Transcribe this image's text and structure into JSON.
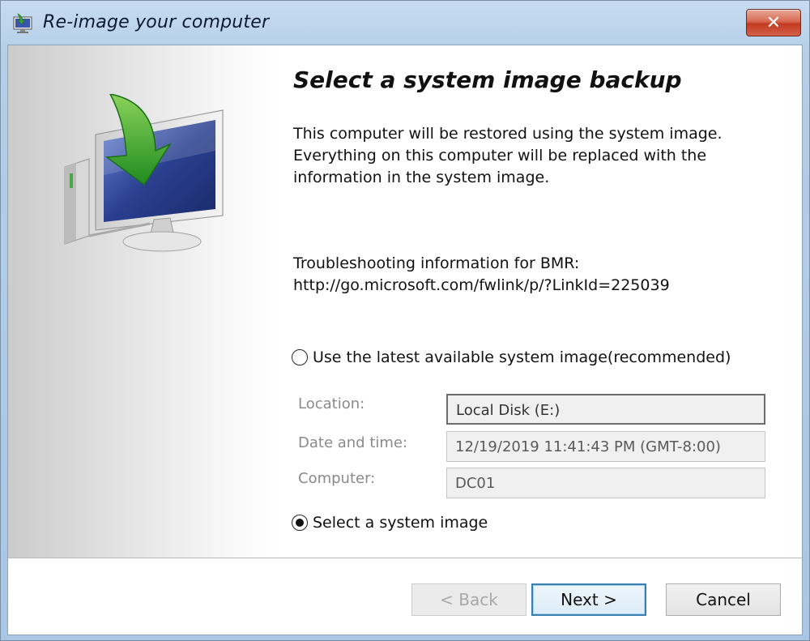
{
  "window": {
    "title": "Re-image your computer",
    "close_label": "✕"
  },
  "main": {
    "heading": "Select a system image backup",
    "description": [
      "This computer will be restored using the system image.",
      "Everything on this computer will be replaced with the",
      "information in the system image."
    ],
    "troubleshooting": {
      "label": "Troubleshooting information for BMR:",
      "url": "http://go.microsoft.com/fwlink/p/?LinkId=225039"
    }
  },
  "options": {
    "latest": {
      "label": "Use the latest available system image(recommended)",
      "selected": false
    },
    "select": {
      "label": "Select a system image",
      "selected": true
    }
  },
  "fields": {
    "location": {
      "label": "Location:",
      "value": "Local Disk (E:)"
    },
    "datetime": {
      "label": "Date and time:",
      "value": "12/19/2019 11:41:43 PM (GMT-8:00)"
    },
    "computer": {
      "label": "Computer:",
      "value": "DC01"
    }
  },
  "buttons": {
    "back": "< Back",
    "next": "Next >",
    "cancel": "Cancel"
  },
  "icons": {
    "title": "restore-monitor-icon",
    "hero": "restore-computer-icon",
    "close": "close-icon"
  },
  "colors": {
    "titlebar": "#b6cfe9",
    "close_button": "#c23a20",
    "accent_arrow": "#3aa13a",
    "monitor_screen": "#2a3f8f",
    "default_button_border": "#3c7fb1"
  }
}
